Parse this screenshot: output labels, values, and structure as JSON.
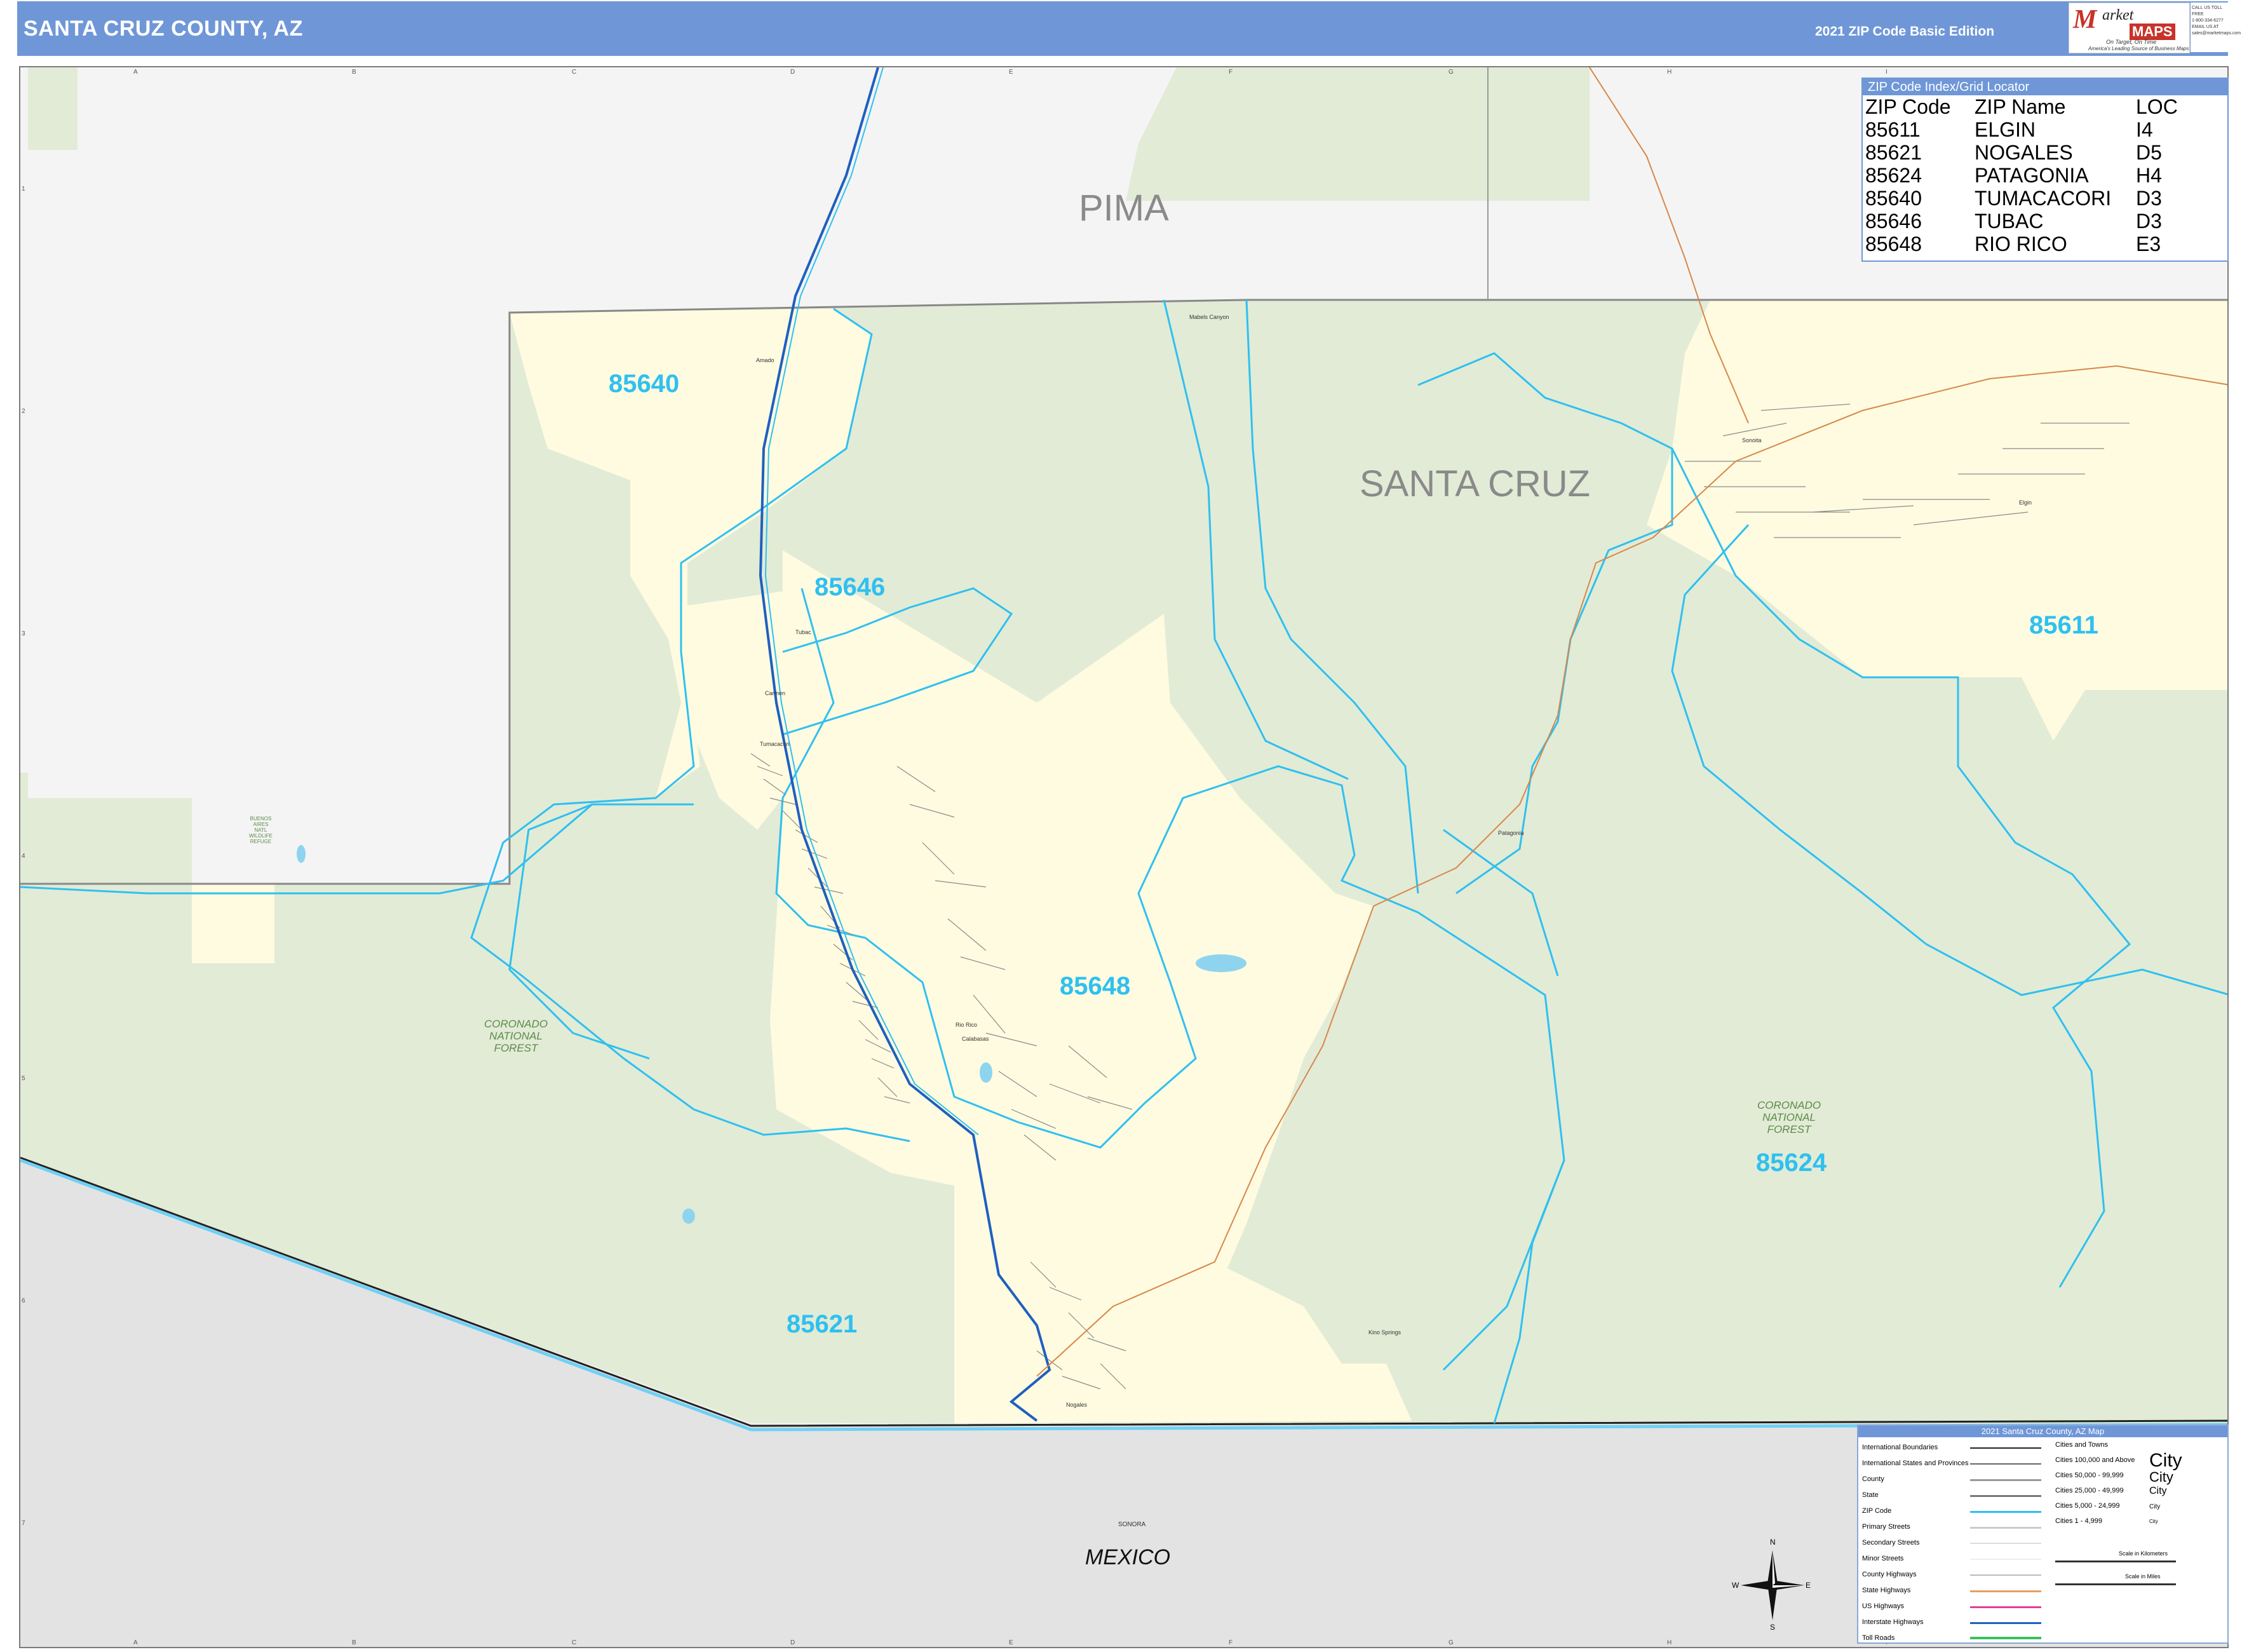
{
  "header": {
    "title": "SANTA CRUZ COUNTY, AZ",
    "edition": "2021 ZIP Code Basic Edition",
    "logo_m": "M",
    "logo_market": "arket",
    "logo_maps": "MAPS",
    "logo_tagline": "On Target, On Time",
    "logo_tagline2": "America's Leading Source of Business Maps",
    "contact_lines": [
      "CALL US TOLL FREE",
      "1-800-334-6277",
      "EMAIL US AT",
      "sales@marketmaps.com"
    ]
  },
  "grid": {
    "columns": [
      "A",
      "B",
      "C",
      "D",
      "E",
      "F",
      "G",
      "H",
      "I"
    ],
    "rows": [
      "1",
      "2",
      "3",
      "4",
      "5",
      "6",
      "7"
    ]
  },
  "map": {
    "county_labels": {
      "pima": "PIMA",
      "santa_cruz": "SANTA CRUZ"
    },
    "country_labels": {
      "mexico": "MEXICO",
      "sonora": "SONORA"
    },
    "forest_labels": [
      "CORONADO\nNATIONAL\nFOREST",
      "CORONADO\nNATIONAL\nFOREST"
    ],
    "reserve_label": "BUENOS\nAIRES\nNATL\nWILDLIFE\nREFUGE",
    "zip_labels": [
      "85640",
      "85646",
      "85648",
      "85611",
      "85621",
      "85624"
    ],
    "towns": [
      "Amado",
      "Tubac",
      "Carmen",
      "Tumacacori",
      "Rio Rico",
      "Calabasas",
      "Nogales",
      "Kino Springs",
      "Patagonia",
      "Sonoita",
      "Elgin",
      "Mabels Canyon"
    ],
    "colors": {
      "zip_area": "#fefbe0",
      "forest": "#e2ebd6",
      "outside": "#f4f4f4",
      "mexico": "#e3e3e3",
      "zip_boundary": "#2fc0f0",
      "interstate": "#1f5fc0"
    }
  },
  "locator": {
    "title": "ZIP Code Index/Grid Locator",
    "headers": [
      "ZIP Code",
      "ZIP Name",
      "LOC"
    ],
    "rows": [
      [
        "85611",
        "ELGIN",
        "I4"
      ],
      [
        "85621",
        "NOGALES",
        "D5"
      ],
      [
        "85624",
        "PATAGONIA",
        "H4"
      ],
      [
        "85640",
        "TUMACACORI",
        "D3"
      ],
      [
        "85646",
        "TUBAC",
        "D3"
      ],
      [
        "85648",
        "RIO RICO",
        "E3"
      ]
    ]
  },
  "legend": {
    "title": "2021 Santa Cruz County, AZ Map",
    "items": [
      "International Boundaries",
      "International States and Provinces",
      "County",
      "State",
      "ZIP Code",
      "Primary Streets",
      "Secondary Streets",
      "Minor Streets",
      "County Highways",
      "State Highways",
      "US Highways",
      "Interstate Highways",
      "Toll Roads"
    ],
    "cities_title": "Cities and Towns",
    "city_rows": [
      "Cities 100,000 and Above",
      "Cities 50,000 - 99,999",
      "Cities 25,000 - 49,999",
      "Cities 5,000 - 24,999",
      "Cities 1 - 4,999"
    ],
    "city_sample": "City",
    "scale_km": "Scale in Kilometers",
    "scale_miles": "Scale in Miles",
    "compass": [
      "N",
      "S",
      "E",
      "W"
    ]
  }
}
